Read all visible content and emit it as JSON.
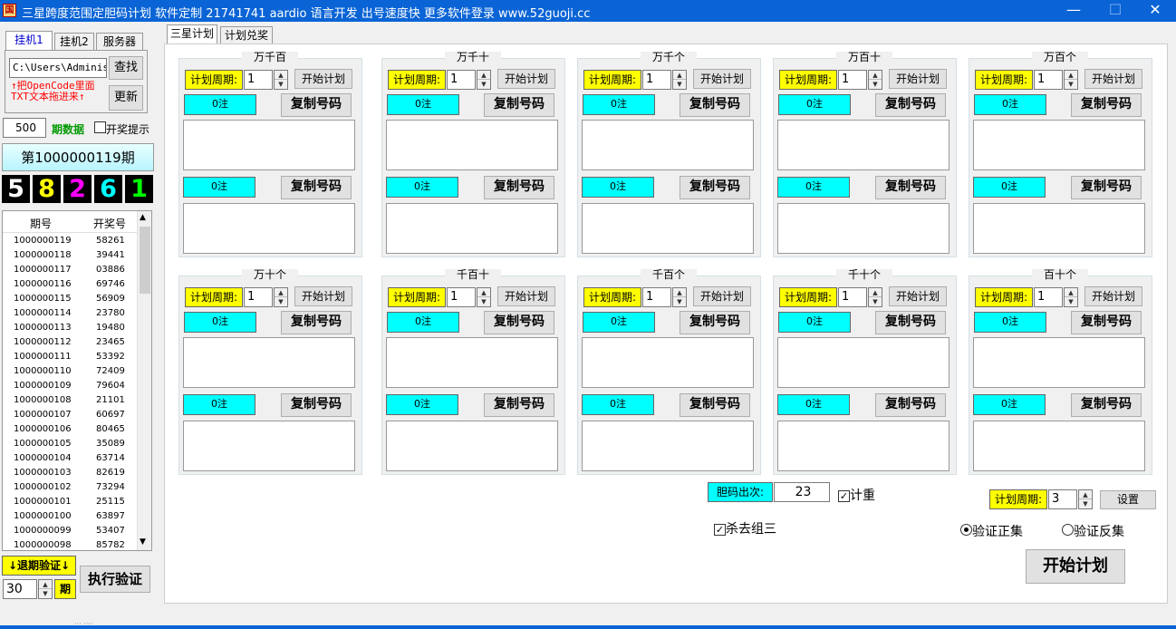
{
  "window": {
    "title": "三星跨度范围定胆码计划 软件定制 21741741 aardio 语言开发 出号速度快 更多软件登录 www.52guoji.cc",
    "app_icon_text": "国"
  },
  "left_tabs": [
    "挂机1",
    "挂机2",
    "服务器"
  ],
  "path_input": "C:\\Users\\Administ",
  "find_button": "查找",
  "update_button": "更新",
  "hint_line1": "↑把OpenCode里面",
  "hint_line2": "TXT文本拖进来↑",
  "period_count": "500",
  "period_data_label": "期数据",
  "open_notice_label": "开奖提示",
  "current_period": "第1000000119期",
  "draw_digits": [
    {
      "d": "5",
      "color": "#ffffff"
    },
    {
      "d": "8",
      "color": "#ffff00"
    },
    {
      "d": "2",
      "color": "#ff00ff"
    },
    {
      "d": "6",
      "color": "#00ffff"
    },
    {
      "d": "1",
      "color": "#00ff00"
    }
  ],
  "history": {
    "headers": [
      "期号",
      "开奖号"
    ],
    "rows": [
      [
        "1000000119",
        "58261"
      ],
      [
        "1000000118",
        "39441"
      ],
      [
        "1000000117",
        "03886"
      ],
      [
        "1000000116",
        "69746"
      ],
      [
        "1000000115",
        "56909"
      ],
      [
        "1000000114",
        "23780"
      ],
      [
        "1000000113",
        "19480"
      ],
      [
        "1000000112",
        "23465"
      ],
      [
        "1000000111",
        "53392"
      ],
      [
        "1000000110",
        "72409"
      ],
      [
        "1000000109",
        "79604"
      ],
      [
        "1000000108",
        "21101"
      ],
      [
        "1000000107",
        "60697"
      ],
      [
        "1000000106",
        "80465"
      ],
      [
        "1000000105",
        "35089"
      ],
      [
        "1000000104",
        "63714"
      ],
      [
        "1000000103",
        "82619"
      ],
      [
        "1000000102",
        "73294"
      ],
      [
        "1000000101",
        "25115"
      ],
      [
        "1000000100",
        "63897"
      ],
      [
        "1000000099",
        "53407"
      ],
      [
        "1000000098",
        "85782"
      ]
    ]
  },
  "backtest_label": "↓退期验证↓",
  "backtest_value": "30",
  "backtest_unit": "期",
  "run_verify_button": "执行验证",
  "main_tabs": [
    "三星计划",
    "计划兑奖"
  ],
  "plan_period_label": "计划周期:",
  "start_plan_button": "开始计划",
  "copy_button": "复制号码",
  "count_text": "0注",
  "panels_row1": [
    {
      "title": "万千百",
      "period": "1"
    },
    {
      "title": "万千十",
      "period": "1"
    },
    {
      "title": "万千个",
      "period": "1"
    },
    {
      "title": "万百十",
      "period": "1"
    },
    {
      "title": "万百个",
      "period": "1"
    }
  ],
  "panels_row2": [
    {
      "title": "万十个",
      "period": "1"
    },
    {
      "title": "千百十",
      "period": "1"
    },
    {
      "title": "千百个",
      "period": "1"
    },
    {
      "title": "千十个",
      "period": "1"
    },
    {
      "title": "百十个",
      "period": "1"
    }
  ],
  "bottom": {
    "dan_label": "胆码出次:",
    "dan_value": "23",
    "dedupe_label": "计重",
    "kill_label": "杀去组三",
    "plan_period_label": "计划周期:",
    "plan_period_value": "3",
    "settings_button": "设置",
    "verify_pos_label": "验证正集",
    "verify_neg_label": "验证反集",
    "start_button": "开始计划"
  },
  "bottom_hint": "··· ····"
}
